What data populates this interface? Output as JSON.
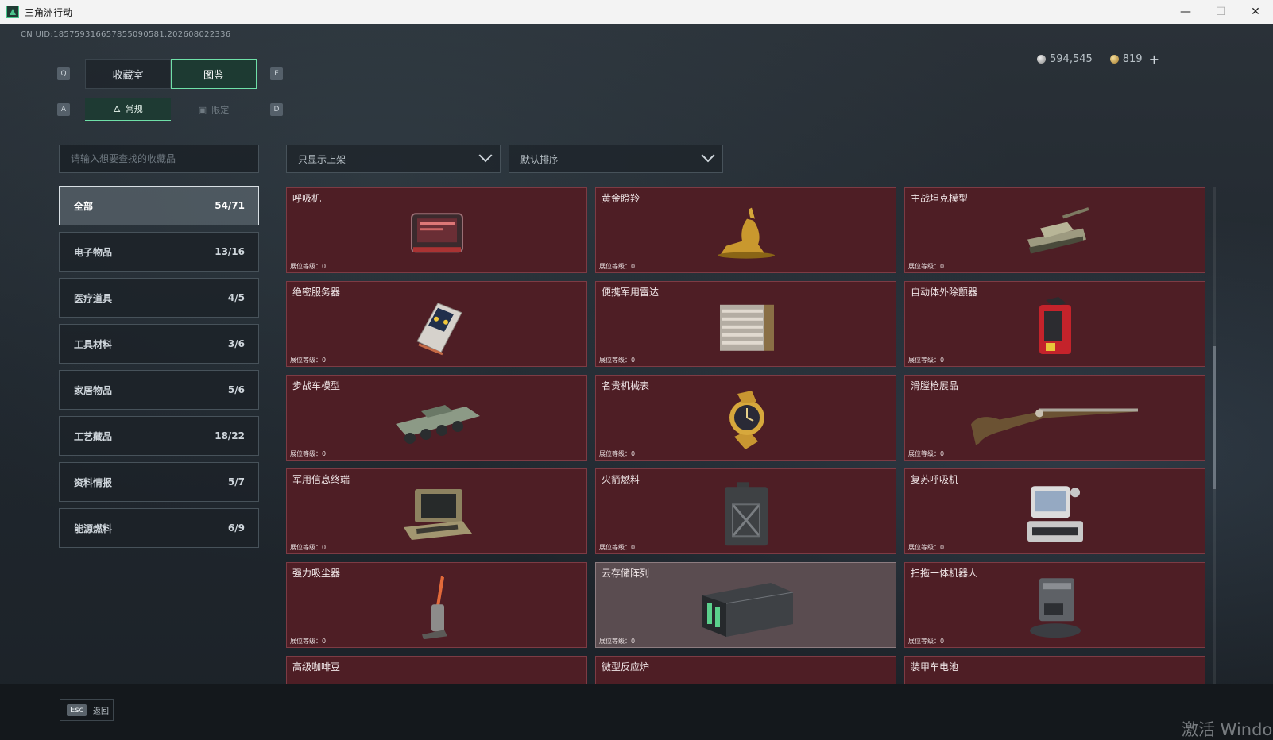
{
  "window": {
    "title": "三角洲行动",
    "minimize": "—",
    "maximize": "☐",
    "close": "✕"
  },
  "uid": "CN UID:1857593166578550905​81.202608022336",
  "currency": {
    "silver": "594,545",
    "gold": "819",
    "add": "+"
  },
  "tabs": {
    "left_key": "Q",
    "right_key": "E",
    "items": [
      {
        "label": "收藏室"
      },
      {
        "label": "图鉴"
      }
    ]
  },
  "subtabs": {
    "left_key": "A",
    "right_key": "D",
    "items": [
      {
        "label": "常规",
        "icon": "flame-icon"
      },
      {
        "label": "限定",
        "icon": "image-icon"
      }
    ]
  },
  "search": {
    "placeholder": "请输入想要查找的收藏品"
  },
  "filters": {
    "listed": "只显示上架",
    "sort": "默认排序"
  },
  "categories": [
    {
      "label": "全部",
      "count": "54/71"
    },
    {
      "label": "电子物品",
      "count": "13/16"
    },
    {
      "label": "医疗道具",
      "count": "4/5"
    },
    {
      "label": "工具材料",
      "count": "3/6"
    },
    {
      "label": "家居物品",
      "count": "5/6"
    },
    {
      "label": "工艺藏品",
      "count": "18/22"
    },
    {
      "label": "资料情报",
      "count": "5/7"
    },
    {
      "label": "能源燃料",
      "count": "6/9"
    }
  ],
  "rank_label": "展位等级：0",
  "items": [
    {
      "name": "呼吸机",
      "icon": "ventilator-icon"
    },
    {
      "name": "黄金瞪羚",
      "icon": "golden-gazelle-icon"
    },
    {
      "name": "主战坦克模型",
      "icon": "tank-model-icon"
    },
    {
      "name": "绝密服务器",
      "icon": "server-icon"
    },
    {
      "name": "便携军用雷达",
      "icon": "radar-icon"
    },
    {
      "name": "自动体外除颤器",
      "icon": "defibrillator-icon"
    },
    {
      "name": "步战车模型",
      "icon": "ifv-model-icon"
    },
    {
      "name": "名贵机械表",
      "icon": "watch-icon"
    },
    {
      "name": "滑膛枪展品",
      "icon": "musket-icon"
    },
    {
      "name": "军用信息终端",
      "icon": "terminal-icon"
    },
    {
      "name": "火箭燃料",
      "icon": "fuel-can-icon"
    },
    {
      "name": "复苏呼吸机",
      "icon": "resuscitator-icon"
    },
    {
      "name": "强力吸尘器",
      "icon": "vacuum-icon"
    },
    {
      "name": "云存储阵列",
      "icon": "storage-array-icon"
    },
    {
      "name": "扫拖一体机器人",
      "icon": "robot-mop-icon"
    },
    {
      "name": "高级咖啡豆",
      "icon": "coffee-beans-icon"
    },
    {
      "name": "微型反应炉",
      "icon": "reactor-icon"
    },
    {
      "name": "装甲车电池",
      "icon": "battery-icon"
    }
  ],
  "bottom": {
    "esc_key": "Esc",
    "esc_label": "返回"
  },
  "watermark": "激活 Windo"
}
